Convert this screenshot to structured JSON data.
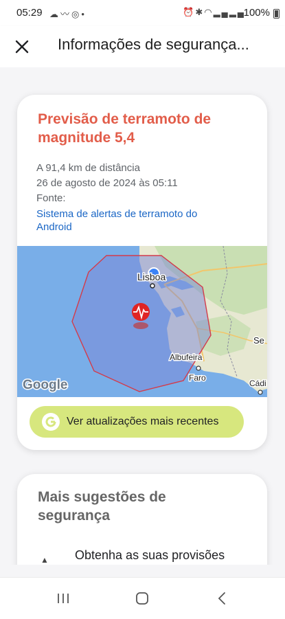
{
  "status_bar": {
    "time": "05:29",
    "left_icons": [
      "cloud-moon-icon",
      "wave-icon",
      "instagram-icon",
      "dot-icon"
    ],
    "right_icons": [
      "alarm-icon",
      "bluetooth-icon",
      "wifi-icon",
      "signal-icon",
      "signal-icon"
    ],
    "battery": "100%"
  },
  "app_bar": {
    "title": "Informações de segurança...",
    "close_icon": "close-icon"
  },
  "alert": {
    "title": "Previsão de terramoto de magnitude 5,4",
    "distance": "A 91,4 km de distância",
    "datetime": "26 de agosto de 2024 às 05:11",
    "source_label": "Fonte:",
    "source_link": "Sistema de alertas de terramoto do Android",
    "map": {
      "labels": {
        "lisboa": "Lisboa",
        "albufeira": "Albufeira",
        "faro": "Faro",
        "se": "Se",
        "cadiz": "Cádi",
        "google": "Google"
      }
    },
    "updates_button": "Ver atualizações mais recentes"
  },
  "tips": {
    "title": "Mais sugestões de segurança",
    "item_1": "Obtenha as suas provisões"
  },
  "colors": {
    "alert_red": "#e25d4a",
    "link_blue": "#1a66c5",
    "button_lime": "#d7e77e",
    "sea_blue": "#79aee8"
  }
}
